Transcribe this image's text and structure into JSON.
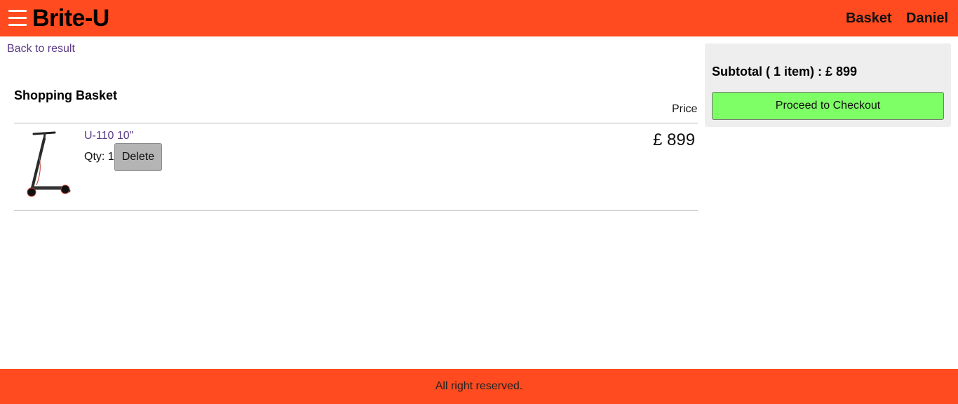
{
  "colors": {
    "brand": "#ff4b1f",
    "link": "#5a3a86",
    "checkout_button": "#7fff66",
    "delete_button": "#b4b4b4",
    "summary_panel": "#eeeeee"
  },
  "header": {
    "menu_icon": "hamburger-menu-icon",
    "logo": "Brite-U",
    "nav": {
      "basket": "Basket",
      "user": "Daniel"
    }
  },
  "main": {
    "back_link": "Back to result",
    "title": "Shopping Basket",
    "price_header": "Price",
    "items": [
      {
        "image": "electric-scooter-image",
        "name": "U-110 10\"",
        "qty_label": "Qty: 1",
        "delete_label": "Delete",
        "price": "£ 899"
      }
    ]
  },
  "summary": {
    "subtotal": "Subtotal ( 1 item) : £ 899",
    "checkout_label": "Proceed to Checkout"
  },
  "footer": {
    "text": "All right reserved."
  }
}
